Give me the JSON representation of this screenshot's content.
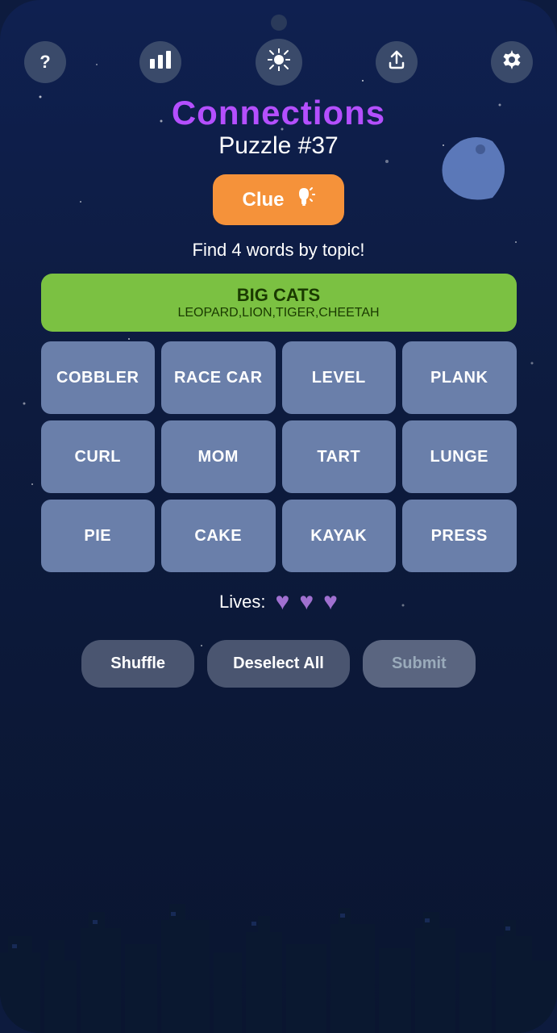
{
  "app": {
    "title": "Connections",
    "puzzle": "Puzzle #37",
    "instruction": "Find 4 words by topic!"
  },
  "icons": {
    "question": "?",
    "chart": "📊",
    "sun": "☀",
    "share": "⬆",
    "gear": "⚙"
  },
  "clue_button": {
    "label": "Clue"
  },
  "solved_category": {
    "title": "BIG CATS",
    "words": "LEOPARD,LION,TIGER,CHEETAH"
  },
  "grid": [
    [
      {
        "word": "COBBLER"
      },
      {
        "word": "RACE CAR"
      },
      {
        "word": "LEVEL"
      },
      {
        "word": "PLANK"
      }
    ],
    [
      {
        "word": "CURL"
      },
      {
        "word": "MOM"
      },
      {
        "word": "TART"
      },
      {
        "word": "LUNGE"
      }
    ],
    [
      {
        "word": "PIE"
      },
      {
        "word": "CAKE"
      },
      {
        "word": "KAYAK"
      },
      {
        "word": "PRESS"
      }
    ]
  ],
  "lives": {
    "label": "Lives:",
    "count": 3
  },
  "buttons": {
    "shuffle": "Shuffle",
    "deselect_all": "Deselect All",
    "submit": "Submit"
  }
}
